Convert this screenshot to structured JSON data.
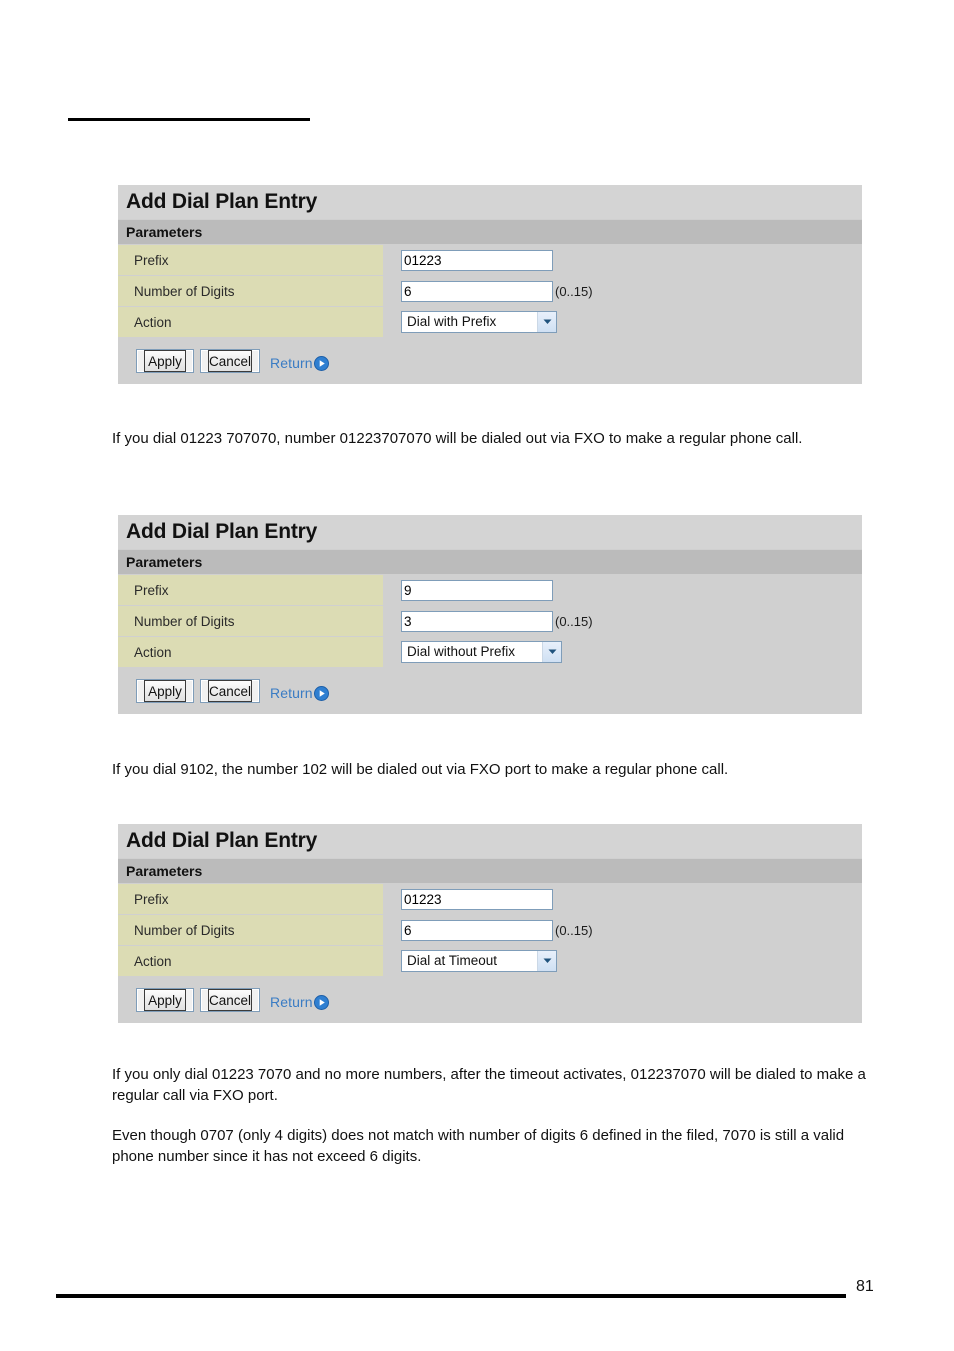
{
  "document": {
    "page_number": "81"
  },
  "panels": [
    {
      "title": "Add Dial Plan Entry",
      "subhead": "Parameters",
      "rows": {
        "prefix_label": "Prefix",
        "prefix_value": "01223",
        "digits_label": "Number of Digits",
        "digits_value": "6",
        "digits_hint": "(0..15)",
        "action_label": "Action",
        "action_value": "Dial with Prefix"
      },
      "buttons": {
        "apply": "Apply",
        "cancel": "Cancel",
        "return": "Return"
      }
    },
    {
      "title": "Add Dial Plan Entry",
      "subhead": "Parameters",
      "rows": {
        "prefix_label": "Prefix",
        "prefix_value": "9",
        "digits_label": "Number of Digits",
        "digits_value": "3",
        "digits_hint": "(0..15)",
        "action_label": "Action",
        "action_value": "Dial without Prefix"
      },
      "buttons": {
        "apply": "Apply",
        "cancel": "Cancel",
        "return": "Return"
      }
    },
    {
      "title": "Add Dial Plan Entry",
      "subhead": "Parameters",
      "rows": {
        "prefix_label": "Prefix",
        "prefix_value": "01223",
        "digits_label": "Number of Digits",
        "digits_value": "6",
        "digits_hint": "(0..15)",
        "action_label": "Action",
        "action_value": "Dial at Timeout"
      },
      "buttons": {
        "apply": "Apply",
        "cancel": "Cancel",
        "return": "Return"
      }
    }
  ],
  "paragraphs": {
    "p1": "If you dial 01223 707070, number 01223707070 will be dialed out via FXO to make a regular phone call.",
    "p2": "If you dial 9102, the number 102 will be dialed out via FXO port to make a regular phone call.",
    "p3": "If you only dial 01223 7070 and no more numbers, after the timeout activates, 012237070 will be dialed to make a regular call via FXO port.",
    "p4": "Even though 0707 (only 4 digits) does not match with number of digits 6 defined in the filed, 7070 is still a valid phone number since it has not exceed 6 digits."
  }
}
